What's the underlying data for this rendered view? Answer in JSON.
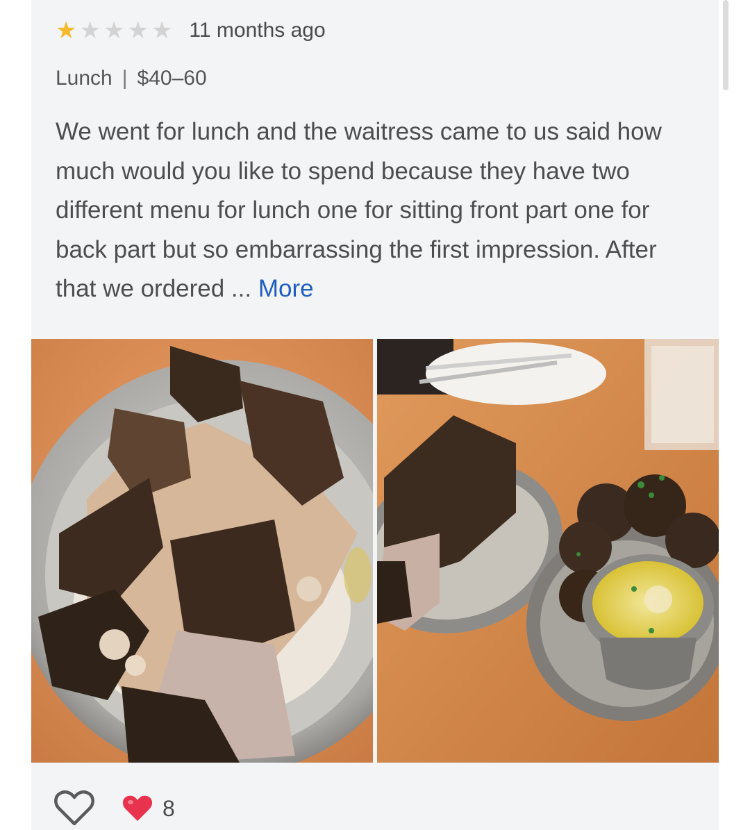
{
  "review": {
    "rating": 1,
    "rating_max": 5,
    "time_ago": "11 months ago",
    "meal": "Lunch",
    "separator": "|",
    "price_range": "$40–60",
    "text": "We went for lunch and the waitress came to us said how much would you like to spend because they have two different menu for lunch one for sitting front part one for back part but so embarrassing the first impression. After that we ordered ...",
    "more_label": "More",
    "photos": [
      {
        "icon": "photo-grilled-chicken-plate"
      },
      {
        "icon": "photo-chicken-and-falafel-with-sauce"
      }
    ],
    "like_icon": "heart-outline-icon",
    "reaction_icon": "red-heart-icon",
    "reaction_count": "8"
  },
  "colors": {
    "star_filled": "#f5b92d",
    "star_empty": "#d3d3d3",
    "link": "#1f5fbf",
    "card_bg": "#f3f4f6"
  }
}
